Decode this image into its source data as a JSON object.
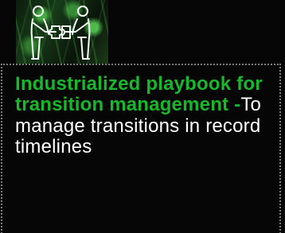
{
  "card": {
    "highlight_text": "Industrialized playbook for transition management -",
    "body_text": "To manage transitions in record timelines"
  },
  "icons": {
    "main": "people-puzzle-icon"
  },
  "colors": {
    "background": "#060606",
    "accent": "#18b72c",
    "text": "#ffffff",
    "dotted_border": "#7d7d7d",
    "icon_glow": "#2f9b36"
  }
}
